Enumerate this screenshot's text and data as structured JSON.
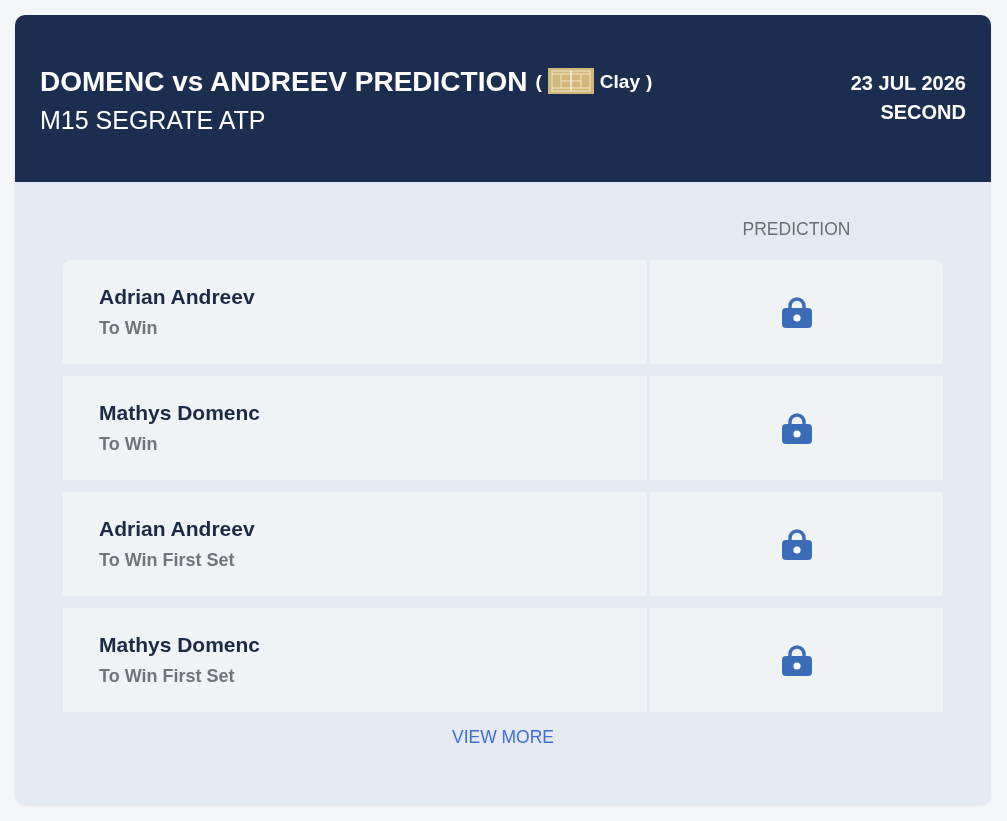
{
  "header": {
    "title": "DOMENC vs ANDREEV PREDICTION",
    "surface": {
      "open_paren": "(",
      "name": "Clay",
      "close_paren": ")"
    },
    "tournament": "M15 SEGRATE ATP",
    "date": "23 JUL 2026",
    "round": "SECOND"
  },
  "table": {
    "prediction_heading": "PREDICTION",
    "rows": [
      {
        "player": "Adrian Andreev",
        "market": "To Win",
        "locked": true
      },
      {
        "player": "Mathys Domenc",
        "market": "To Win",
        "locked": true
      },
      {
        "player": "Adrian Andreev",
        "market": "To Win First Set",
        "locked": true
      },
      {
        "player": "Mathys Domenc",
        "market": "To Win First Set",
        "locked": true
      }
    ]
  },
  "view_more": "VIEW MORE"
}
